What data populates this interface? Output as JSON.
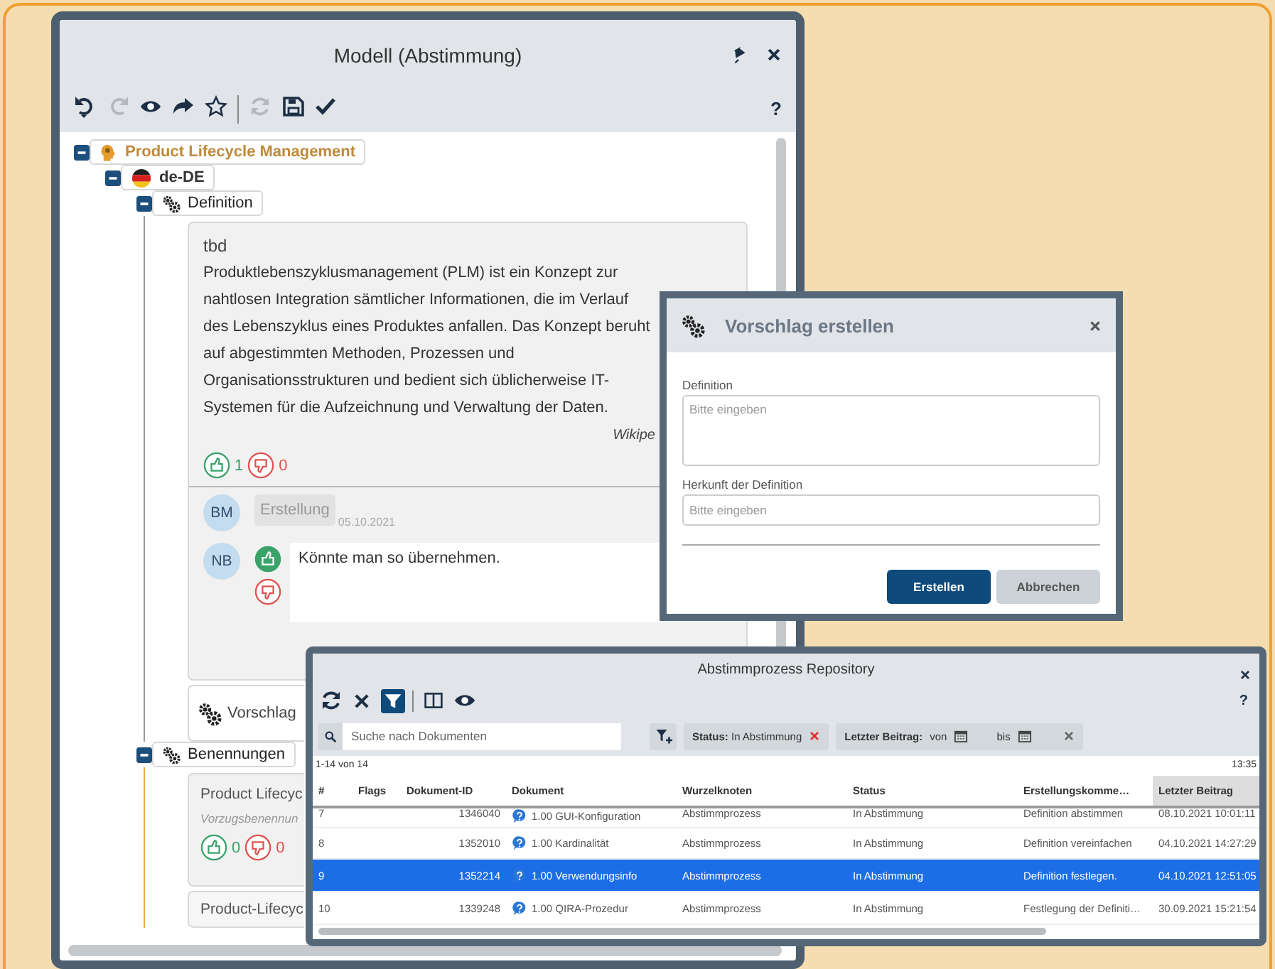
{
  "model_window": {
    "title": "Modell (Abstimmung)",
    "help": "?",
    "toolbar": [
      {
        "kind": "undo",
        "disabled": false
      },
      {
        "kind": "redo",
        "disabled": true
      },
      {
        "kind": "view",
        "disabled": false
      },
      {
        "kind": "forward",
        "disabled": false
      },
      {
        "kind": "favorite",
        "disabled": false
      },
      {
        "kind": "separator"
      },
      {
        "kind": "refresh",
        "disabled": true
      },
      {
        "kind": "save",
        "disabled": false
      },
      {
        "kind": "approve",
        "disabled": false
      }
    ],
    "tree": [
      {
        "label": "Product Lifecycle Management",
        "kind": "concept",
        "expanded": true,
        "children": [
          {
            "label": "de-DE",
            "kind": "language",
            "expanded": true,
            "children": [
              {
                "label": "Definition",
                "kind": "section",
                "expanded": true,
                "cards": [
                  {
                    "kind": "definition",
                    "status": "tbd",
                    "text": "Produktlebenszyklusmanagement (PLM) ist ein Konzept zur nahtlosen Integration sämtlicher Informationen, die im Verlauf des Lebenszyklus eines Produktes anfallen. Das Konzept beruht auf abgestimmten Methoden, Prozessen und Organisationsstrukturen und bedient sich üblicherweise IT-Systemen für die Aufzeichnung und Verwaltung der Daten.",
                    "source": "Wikipe",
                    "likes": "1",
                    "dislikes": "0",
                    "comments": [
                      {
                        "kind": "event",
                        "initials": "BM",
                        "label": "Erstellung",
                        "date": "05.10.2021"
                      },
                      {
                        "kind": "vote",
                        "initials": "NB",
                        "liked": true,
                        "text": "Könnte man so übernehmen."
                      }
                    ]
                  },
                  {
                    "kind": "proposal",
                    "label": "Vorschlag"
                  }
                ]
              },
              {
                "label": "Benennungen",
                "kind": "section",
                "expanded": true,
                "cards": [
                  {
                    "kind": "term",
                    "title": "Product Lifecyc",
                    "subtitle": "Vorzugsbenennun",
                    "likes": "0",
                    "dislikes": "0"
                  },
                  {
                    "kind": "term",
                    "title": "Product-Lifecyc"
                  }
                ]
              }
            ]
          }
        ]
      }
    ]
  },
  "dialog": {
    "title": "Vorschlag erstellen",
    "fields": [
      {
        "kind": "textarea",
        "label": "Definition",
        "placeholder": "Bitte eingeben"
      },
      {
        "kind": "text",
        "label": "Herkunft der Definition",
        "placeholder": "Bitte eingeben"
      }
    ],
    "buttons": [
      {
        "kind": "primary",
        "label": "Erstellen"
      },
      {
        "kind": "secondary",
        "label": "Abbrechen"
      }
    ]
  },
  "repository": {
    "title": "Abstimmprozess Repository",
    "help": "?",
    "toolbar": [
      {
        "kind": "refresh",
        "selected": false
      },
      {
        "kind": "clear",
        "selected": false
      },
      {
        "kind": "filter",
        "selected": true
      },
      {
        "kind": "separator"
      },
      {
        "kind": "columns",
        "selected": false
      },
      {
        "kind": "view",
        "selected": false
      }
    ],
    "search": {
      "placeholder": "Suche nach Dokumenten"
    },
    "filters": [
      {
        "kind": "status",
        "text": "**Status:** In Abstimmung"
      },
      {
        "kind": "date",
        "label": "Letzter Beitrag:",
        "from": "von",
        "to": "bis"
      }
    ],
    "count": "1-14 von 14",
    "time": "13:35",
    "table": {
      "columns": [
        {
          "label": "#",
          "sorted": false
        },
        {
          "label": "Flags",
          "sorted": false
        },
        {
          "label": "Dokument-ID",
          "sorted": false
        },
        {
          "label": "Dokument",
          "sorted": false
        },
        {
          "label": "Wurzelknoten",
          "sorted": false
        },
        {
          "label": "Status",
          "sorted": false
        },
        {
          "label": "Erstellungskomme…",
          "sorted": false
        },
        {
          "label": "Letzter Beitrag",
          "sorted": true
        }
      ],
      "rows": [
        {
          "number": "7",
          "id": "1346040",
          "document": "1.00 GUI-Konfiguration",
          "root": "Abstimmprozess",
          "status": "In Abstimmung",
          "comment": "Definition abstimmen",
          "last_post": "08.10.2021 10:01:11",
          "selected": false
        },
        {
          "number": "8",
          "id": "1352010",
          "document": "1.00 Kardinalität",
          "root": "Abstimmprozess",
          "status": "In Abstimmung",
          "comment": "Definition vereinfachen",
          "last_post": "04.10.2021 14:27:29",
          "selected": false
        },
        {
          "number": "9",
          "id": "1352214",
          "document": "1.00 Verwendungsinfo",
          "root": "Abstimmprozess",
          "status": "In Abstimmung",
          "comment": "Definition festlegen.",
          "last_post": "04.10.2021 12:51:05",
          "selected": true
        },
        {
          "number": "10",
          "id": "1339248",
          "document": "1.00 QIRA-Prozedur",
          "root": "Abstimmprozess",
          "status": "In Abstimmung",
          "comment": "Festlegung der Definiti…",
          "last_post": "30.09.2021 15:21:54",
          "selected": false
        }
      ]
    }
  }
}
